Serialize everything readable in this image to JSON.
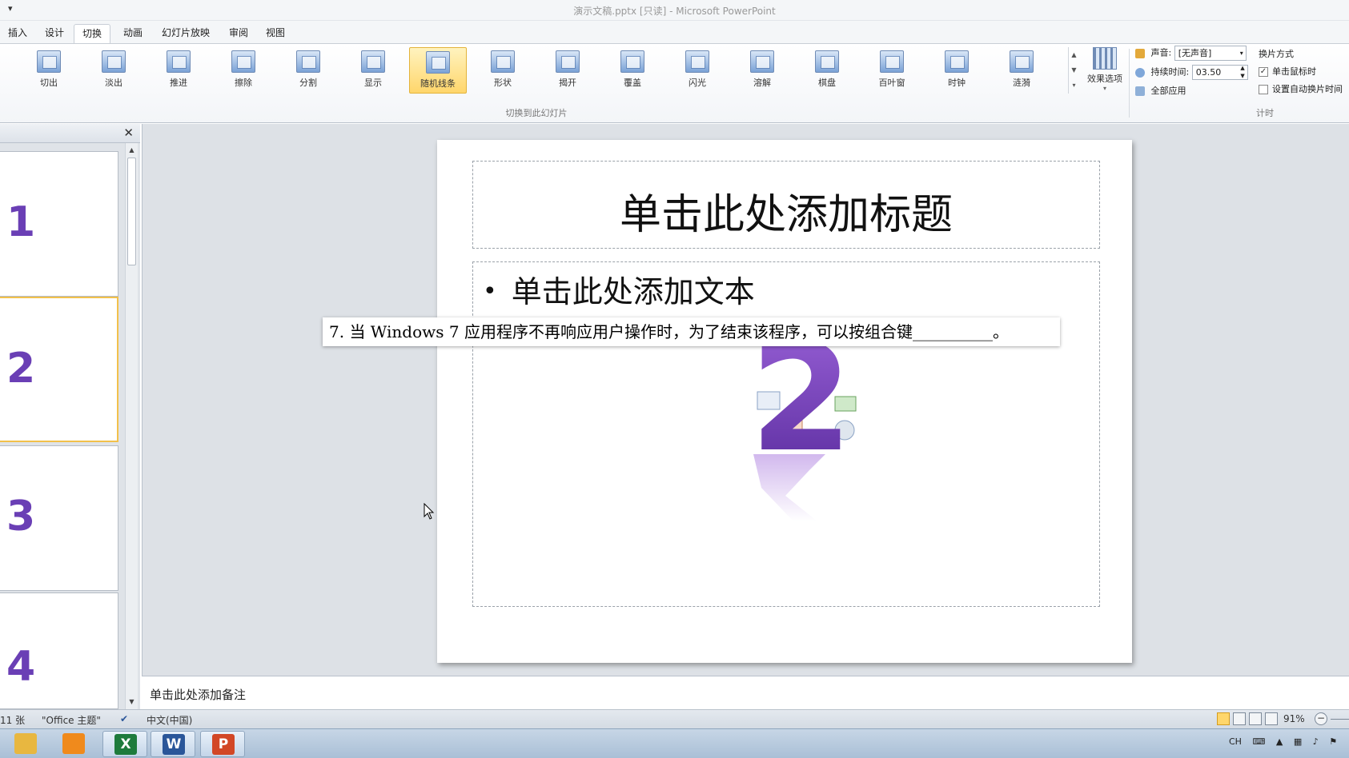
{
  "window": {
    "qat_symbol": "▾",
    "title": "演示文稿.pptx [只读]  -  Microsoft PowerPoint"
  },
  "tabs": [
    "插入",
    "设计",
    "切换",
    "动画",
    "幻灯片放映",
    "审阅",
    "视图"
  ],
  "active_tab": "切换",
  "ribbon": {
    "transitions": [
      {
        "label": "切出",
        "icon": "cut-transition-icon"
      },
      {
        "label": "淡出",
        "icon": "fade-transition-icon"
      },
      {
        "label": "推进",
        "icon": "push-transition-icon"
      },
      {
        "label": "擦除",
        "icon": "wipe-transition-icon"
      },
      {
        "label": "分割",
        "icon": "split-transition-icon"
      },
      {
        "label": "显示",
        "icon": "reveal-transition-icon"
      },
      {
        "label": "随机线条",
        "icon": "random-bars-transition-icon",
        "selected": true
      },
      {
        "label": "形状",
        "icon": "shape-transition-icon"
      },
      {
        "label": "揭开",
        "icon": "uncover-transition-icon"
      },
      {
        "label": "覆盖",
        "icon": "cover-transition-icon"
      },
      {
        "label": "闪光",
        "icon": "flash-transition-icon"
      },
      {
        "label": "溶解",
        "icon": "dissolve-transition-icon"
      },
      {
        "label": "棋盘",
        "icon": "checkerboard-transition-icon"
      },
      {
        "label": "百叶窗",
        "icon": "blinds-transition-icon"
      },
      {
        "label": "时钟",
        "icon": "clock-transition-icon"
      },
      {
        "label": "涟漪",
        "icon": "ripple-transition-icon"
      }
    ],
    "effect_options_label": "效果选项",
    "group_label": "切换到此幻灯片",
    "sound_label": "声音:",
    "sound_value": "[无声音]",
    "duration_label": "持续时间:",
    "duration_value": "03.50",
    "apply_all_label": "全部应用",
    "advance_header": "换片方式",
    "on_click_label": "单击鼠标时",
    "on_click_checked": true,
    "auto_after_label": "设置自动换片时间",
    "auto_after_checked": false,
    "timing_group_label": "计时"
  },
  "thumbnails": [
    {
      "number": "1"
    },
    {
      "number": "2",
      "active": true
    },
    {
      "number": "3"
    },
    {
      "number": "4"
    }
  ],
  "slide": {
    "title_placeholder": "单击此处添加标题",
    "bullet": "•",
    "body_placeholder": "单击此处添加文本",
    "graphic_number": "2"
  },
  "question": "7. 当 Windows 7 应用程序不再响应用户操作时，为了结束该程序，可以按组合键__________。",
  "notes_placeholder": "单击此处添加备注",
  "statusbar": {
    "slide_count": "11 张",
    "theme": "\"Office 主题\"",
    "language": "中文(中国)",
    "zoom": "91%"
  },
  "taskbar": {
    "apps": [
      {
        "name": "explorer",
        "letter": "",
        "color": "#e8b740"
      },
      {
        "name": "media-player",
        "letter": "",
        "color": "#f08a1c"
      },
      {
        "name": "excel",
        "letter": "X",
        "color": "#1e7b3c"
      },
      {
        "name": "word",
        "letter": "W",
        "color": "#2a5699"
      },
      {
        "name": "powerpoint",
        "letter": "P",
        "color": "#d24726"
      }
    ],
    "tray_lang": "CH"
  }
}
